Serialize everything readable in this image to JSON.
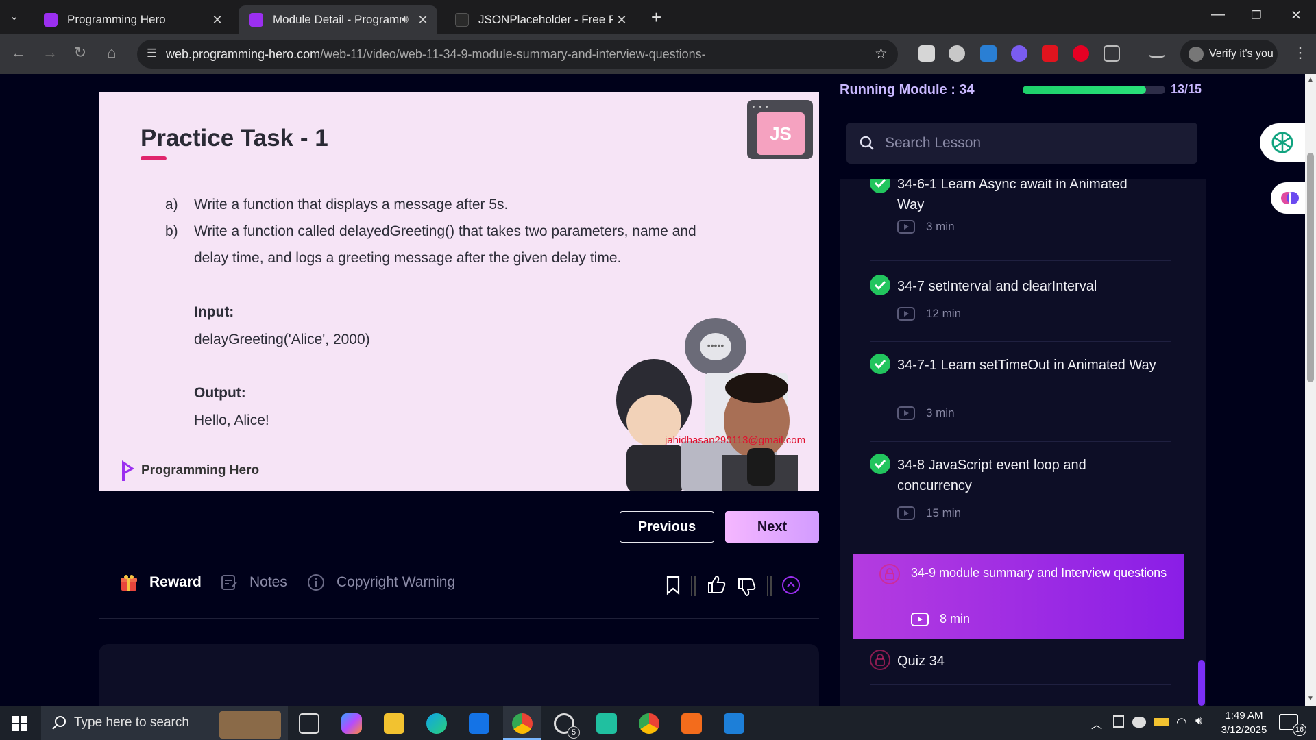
{
  "browser": {
    "tabs": [
      {
        "title": "Programming Hero",
        "active": false
      },
      {
        "title": "Module Detail - Programmi",
        "active": true
      },
      {
        "title": "JSONPlaceholder - Free Fake RE",
        "active": false
      }
    ],
    "url_host": "web.programming-hero.com",
    "url_path": "/web-11/video/web-11-34-9-module-summary-and-interview-questions-",
    "verify_label": "Verify it's you"
  },
  "video": {
    "title": "Practice Task - 1",
    "task_a_letter": "a)",
    "task_a": "Write a function that displays a message after 5s.",
    "task_b_letter": "b)",
    "task_b_line1": "Write a function called delayedGreeting() that takes two parameters, name and",
    "task_b_line2": "delay time, and logs a greeting message after the given delay time.",
    "input_label": "Input:",
    "input_value": "delayGreeting('Alice', 2000)",
    "output_label": "Output:",
    "output_value": "Hello, Alice!",
    "badge": "JS",
    "brand": "Programming Hero",
    "watermark_email": "jahidhasan290113@gmail.com"
  },
  "controls": {
    "previous": "Previous",
    "next": "Next"
  },
  "actions": {
    "reward": "Reward",
    "notes": "Notes",
    "copyright": "Copyright Warning"
  },
  "sidebar": {
    "running_module": "Running Module : 34",
    "progress_fraction": 0.8667,
    "progress_count": "13/15",
    "search_placeholder": "Search Lesson",
    "lessons": [
      {
        "title": "34-6-1 Learn Async await in Animated Way",
        "duration": "3 min",
        "status": "done"
      },
      {
        "title": "34-7 setInterval and clearInterval",
        "duration": "12 min",
        "status": "done"
      },
      {
        "title": "34-7-1 Learn setTimeOut in Animated Way",
        "duration": "3 min",
        "status": "done"
      },
      {
        "title": "34-8 JavaScript event loop and concurrency",
        "duration": "15 min",
        "status": "done"
      },
      {
        "title": "34-9 module summary and Interview questions",
        "duration": "8 min",
        "status": "active"
      },
      {
        "title": "Quiz 34",
        "duration": "",
        "status": "locked"
      }
    ]
  },
  "taskbar": {
    "search_placeholder": "Type here to search",
    "time": "1:49 AM",
    "date": "3/12/2025",
    "whatsapp_badge": "5",
    "notif_count": "16"
  },
  "colors": {
    "page_bg": "#00011a",
    "accent_purple": "#8a1ee6",
    "progress_green": "#1ed16b",
    "check_green": "#22c55e",
    "lock_pink": "#e0246c"
  }
}
